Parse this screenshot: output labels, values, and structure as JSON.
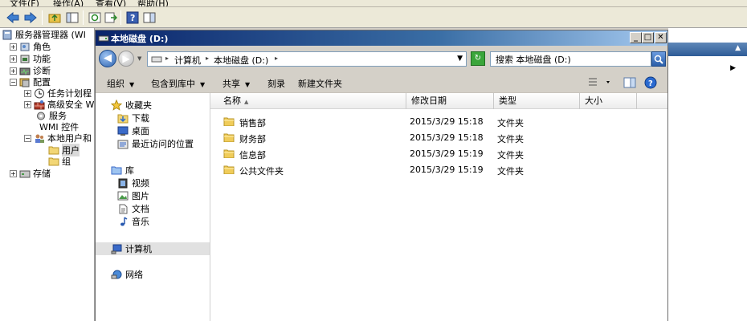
{
  "bg": {
    "menu": [
      "文件(F)",
      "操作(A)",
      "查看(V)",
      "帮助(H)"
    ],
    "tree": [
      {
        "label": "服务器管理器 (WI",
        "exp": "",
        "indent": 0,
        "icon": "server-icon"
      },
      {
        "label": "角色",
        "exp": "+",
        "indent": 1,
        "icon": "roles-icon"
      },
      {
        "label": "功能",
        "exp": "+",
        "indent": 1,
        "icon": "features-icon"
      },
      {
        "label": "诊断",
        "exp": "+",
        "indent": 1,
        "icon": "diagnostics-icon"
      },
      {
        "label": "配置",
        "exp": "−",
        "indent": 1,
        "icon": "configuration-icon"
      },
      {
        "label": "任务计划程",
        "exp": "+",
        "indent": 2,
        "icon": "clock-icon"
      },
      {
        "label": "高级安全 W",
        "exp": "+",
        "indent": 2,
        "icon": "firewall-icon"
      },
      {
        "label": "服务",
        "exp": "",
        "indent": 2,
        "icon": "services-icon"
      },
      {
        "label": "WMI 控件",
        "exp": "",
        "indent": 2,
        "icon": "wmi-icon"
      },
      {
        "label": "本地用户和",
        "exp": "−",
        "indent": 2,
        "icon": "users-icon"
      },
      {
        "label": "用户",
        "exp": "",
        "indent": 3,
        "icon": "folder-icon"
      },
      {
        "label": "组",
        "exp": "",
        "indent": 3,
        "icon": "folder-icon"
      },
      {
        "label": "存储",
        "exp": "+",
        "indent": 1,
        "icon": "storage-icon"
      }
    ]
  },
  "window": {
    "title": "本地磁盘 (D:)",
    "address": {
      "computer": "计算机",
      "drive": "本地磁盘 (D:)"
    },
    "search_placeholder": "搜索 本地磁盘 (D:)",
    "commands": {
      "organize": "组织",
      "include_library": "包含到库中",
      "share": "共享",
      "burn": "刻录",
      "new_folder": "新建文件夹"
    },
    "nav": {
      "favorites": "收藏夹",
      "downloads": "下载",
      "desktop": "桌面",
      "recent": "最近访问的位置",
      "libraries": "库",
      "videos": "视频",
      "pictures": "图片",
      "documents": "文档",
      "music": "音乐",
      "computer": "计算机",
      "network": "网络"
    },
    "columns": {
      "name": "名称",
      "modified": "修改日期",
      "type": "类型",
      "size": "大小"
    },
    "files": [
      {
        "name": "销售部",
        "modified": "2015/3/29 15:18",
        "type": "文件夹"
      },
      {
        "name": "财务部",
        "modified": "2015/3/29 15:18",
        "type": "文件夹"
      },
      {
        "name": "信息部",
        "modified": "2015/3/29 15:19",
        "type": "文件夹"
      },
      {
        "name": "公共文件夹",
        "modified": "2015/3/29 15:19",
        "type": "文件夹"
      }
    ]
  }
}
